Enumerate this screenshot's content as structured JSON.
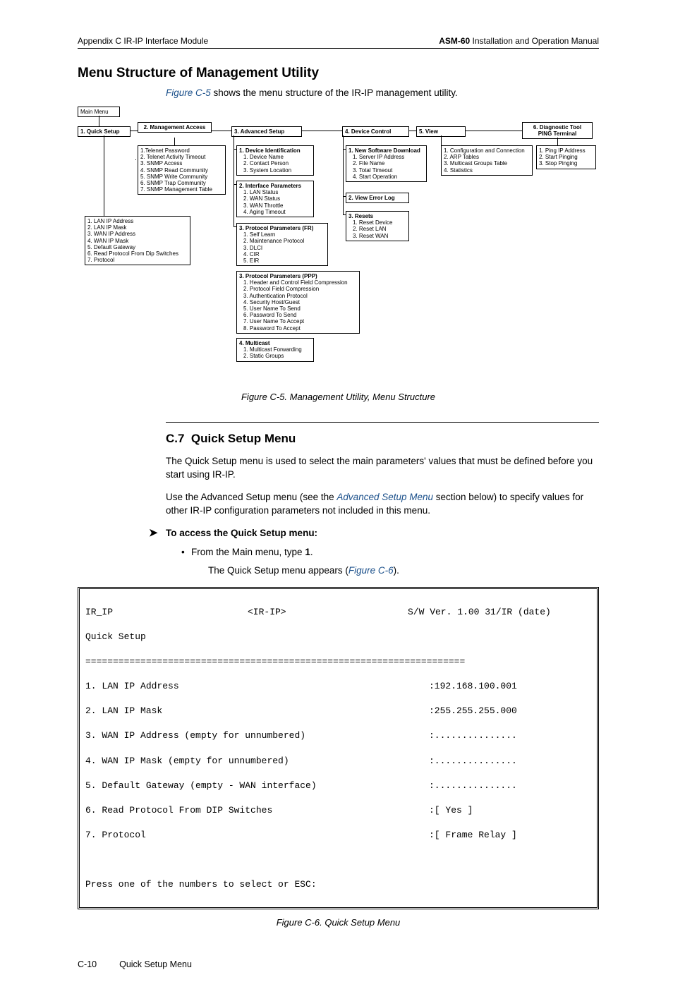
{
  "header": {
    "left": "Appendix C  IR-IP Interface Module",
    "right_bold": "ASM-60",
    "right_rest": " Installation and Operation Manual"
  },
  "section_title": "Menu Structure of Management Utility",
  "intro_sentence_pre": " shows the menu structure of the IR-IP management utility.",
  "intro_figref": "Figure C-5",
  "diagram": {
    "main_menu": "Main Menu",
    "quick_setup": "1. Quick Setup",
    "management_access": "2. Management Access",
    "advanced_setup": "3. Advanced Setup",
    "device_control": "4. Device Control",
    "view": "5. View",
    "diag_tool_l1": "6. Diagnostic Tool",
    "diag_tool_l2": "PING Terminal",
    "mgmt_items": [
      "1.Telenet Password",
      "2. Telenet Activity Timeout",
      "3. SNMP Access",
      "4. SNMP Read Community",
      "5. SNMP Write Community",
      "6. SNMP Trap Community",
      "7. SNMP Management Table"
    ],
    "quick_items": [
      "1. LAN IP Address",
      "2. LAN IP Mask",
      "3. WAN IP Address",
      "4. WAN IP Mask",
      "5. Default Gateway",
      "6. Read Protocol From Dip Switches",
      "7. Protocol"
    ],
    "adv_devid_t": "1. Device Identification",
    "adv_devid": [
      "1. Device Name",
      "2. Contact Person",
      "3. System Location"
    ],
    "adv_if_t": "2. Interface Parameters",
    "adv_if": [
      "1. LAN Status",
      "2. WAN Status",
      "3. WAN Throttle",
      "4. Aging Timeout"
    ],
    "adv_fr_t": "3. Protocol Parameters (FR)",
    "adv_fr": [
      "1. Self Learn",
      "2. Maintenance Protocol",
      "3. DLCI",
      "4. CIR",
      "5. EIR"
    ],
    "adv_ppp_t": "3. Protocol Parameters (PPP)",
    "adv_ppp": [
      "1. Header and Control Field Compression",
      "2. Protocol Field Compression",
      "3. Authentication Protocol",
      "4. Security Host/Guest",
      "5. User Name To Send",
      "6. Password To Send",
      "7. User Name To Accept",
      "8. Password To Accept"
    ],
    "adv_mc_t": "4. Multicast",
    "adv_mc": [
      "1. Multicast Forwarding",
      "2. Static Groups"
    ],
    "dc_swdl_t": "1. New Software Download",
    "dc_swdl": [
      "1. Server IP Address",
      "2. File Name",
      "3. Total Timeout",
      "4. Start Operation"
    ],
    "dc_err": "2. View Error Log",
    "dc_res_t": "3. Resets",
    "dc_res": [
      "1. Reset Device",
      "2. Reset LAN",
      "3. Reset WAN"
    ],
    "view_items": [
      "1. Configuration and Connection",
      "2. ARP Tables",
      "3. Multicast Groups Table",
      "4. Statistics"
    ],
    "diag_items": [
      "1. Ping IP Address",
      "2. Start Pinging",
      "3. Stop Pinging"
    ]
  },
  "fig_c5_caption": "Figure C-5.  Management Utility, Menu Structure",
  "subsection_number": "C.7",
  "subsection_title": "Quick Setup Menu",
  "body1": "The Quick Setup menu is used to select the main parameters' values that must be defined before you start using IR-IP.",
  "body2_pre": "Use the Advanced Setup menu (see the ",
  "body2_link": "Advanced Setup Menu",
  "body2_post": " section below) to specify values for other IR-IP configuration parameters not included in this menu.",
  "proc_heading": "To access the Quick Setup menu:",
  "step1_pre": "From the Main menu, type ",
  "step1_bold": "1",
  "step1_post": ".",
  "result_pre": "The Quick Setup menu appears (",
  "result_link": "Figure C-6",
  "result_post": ").",
  "terminal": {
    "h_left": "IR_IP",
    "h_mid": "<IR-IP>",
    "h_right": "S/W Ver. 1.00 31/IR (date)",
    "subtitle": "Quick Setup",
    "rule": "=====================================================================",
    "rows": [
      {
        "l": "1. LAN IP Address",
        "r": ":192.168.100.001"
      },
      {
        "l": "2. LAN IP Mask",
        "r": ":255.255.255.000"
      },
      {
        "l": "3. WAN IP Address (empty for unnumbered)",
        "r": ":..............."
      },
      {
        "l": "4. WAN IP Mask (empty for unnumbered)",
        "r": ":..............."
      },
      {
        "l": "5. Default Gateway (empty - WAN interface)",
        "r": ":..............."
      },
      {
        "l": "6. Read Protocol From DIP Switches",
        "r": ":[ Yes ]"
      },
      {
        "l": "7. Protocol",
        "r": ":[ Frame Relay ]"
      }
    ],
    "prompt": "Press one of the numbers to select or ESC:"
  },
  "fig_c6_caption": "Figure C-6.  Quick Setup Menu",
  "footer": {
    "page": "C-10",
    "label": "Quick Setup Menu"
  }
}
